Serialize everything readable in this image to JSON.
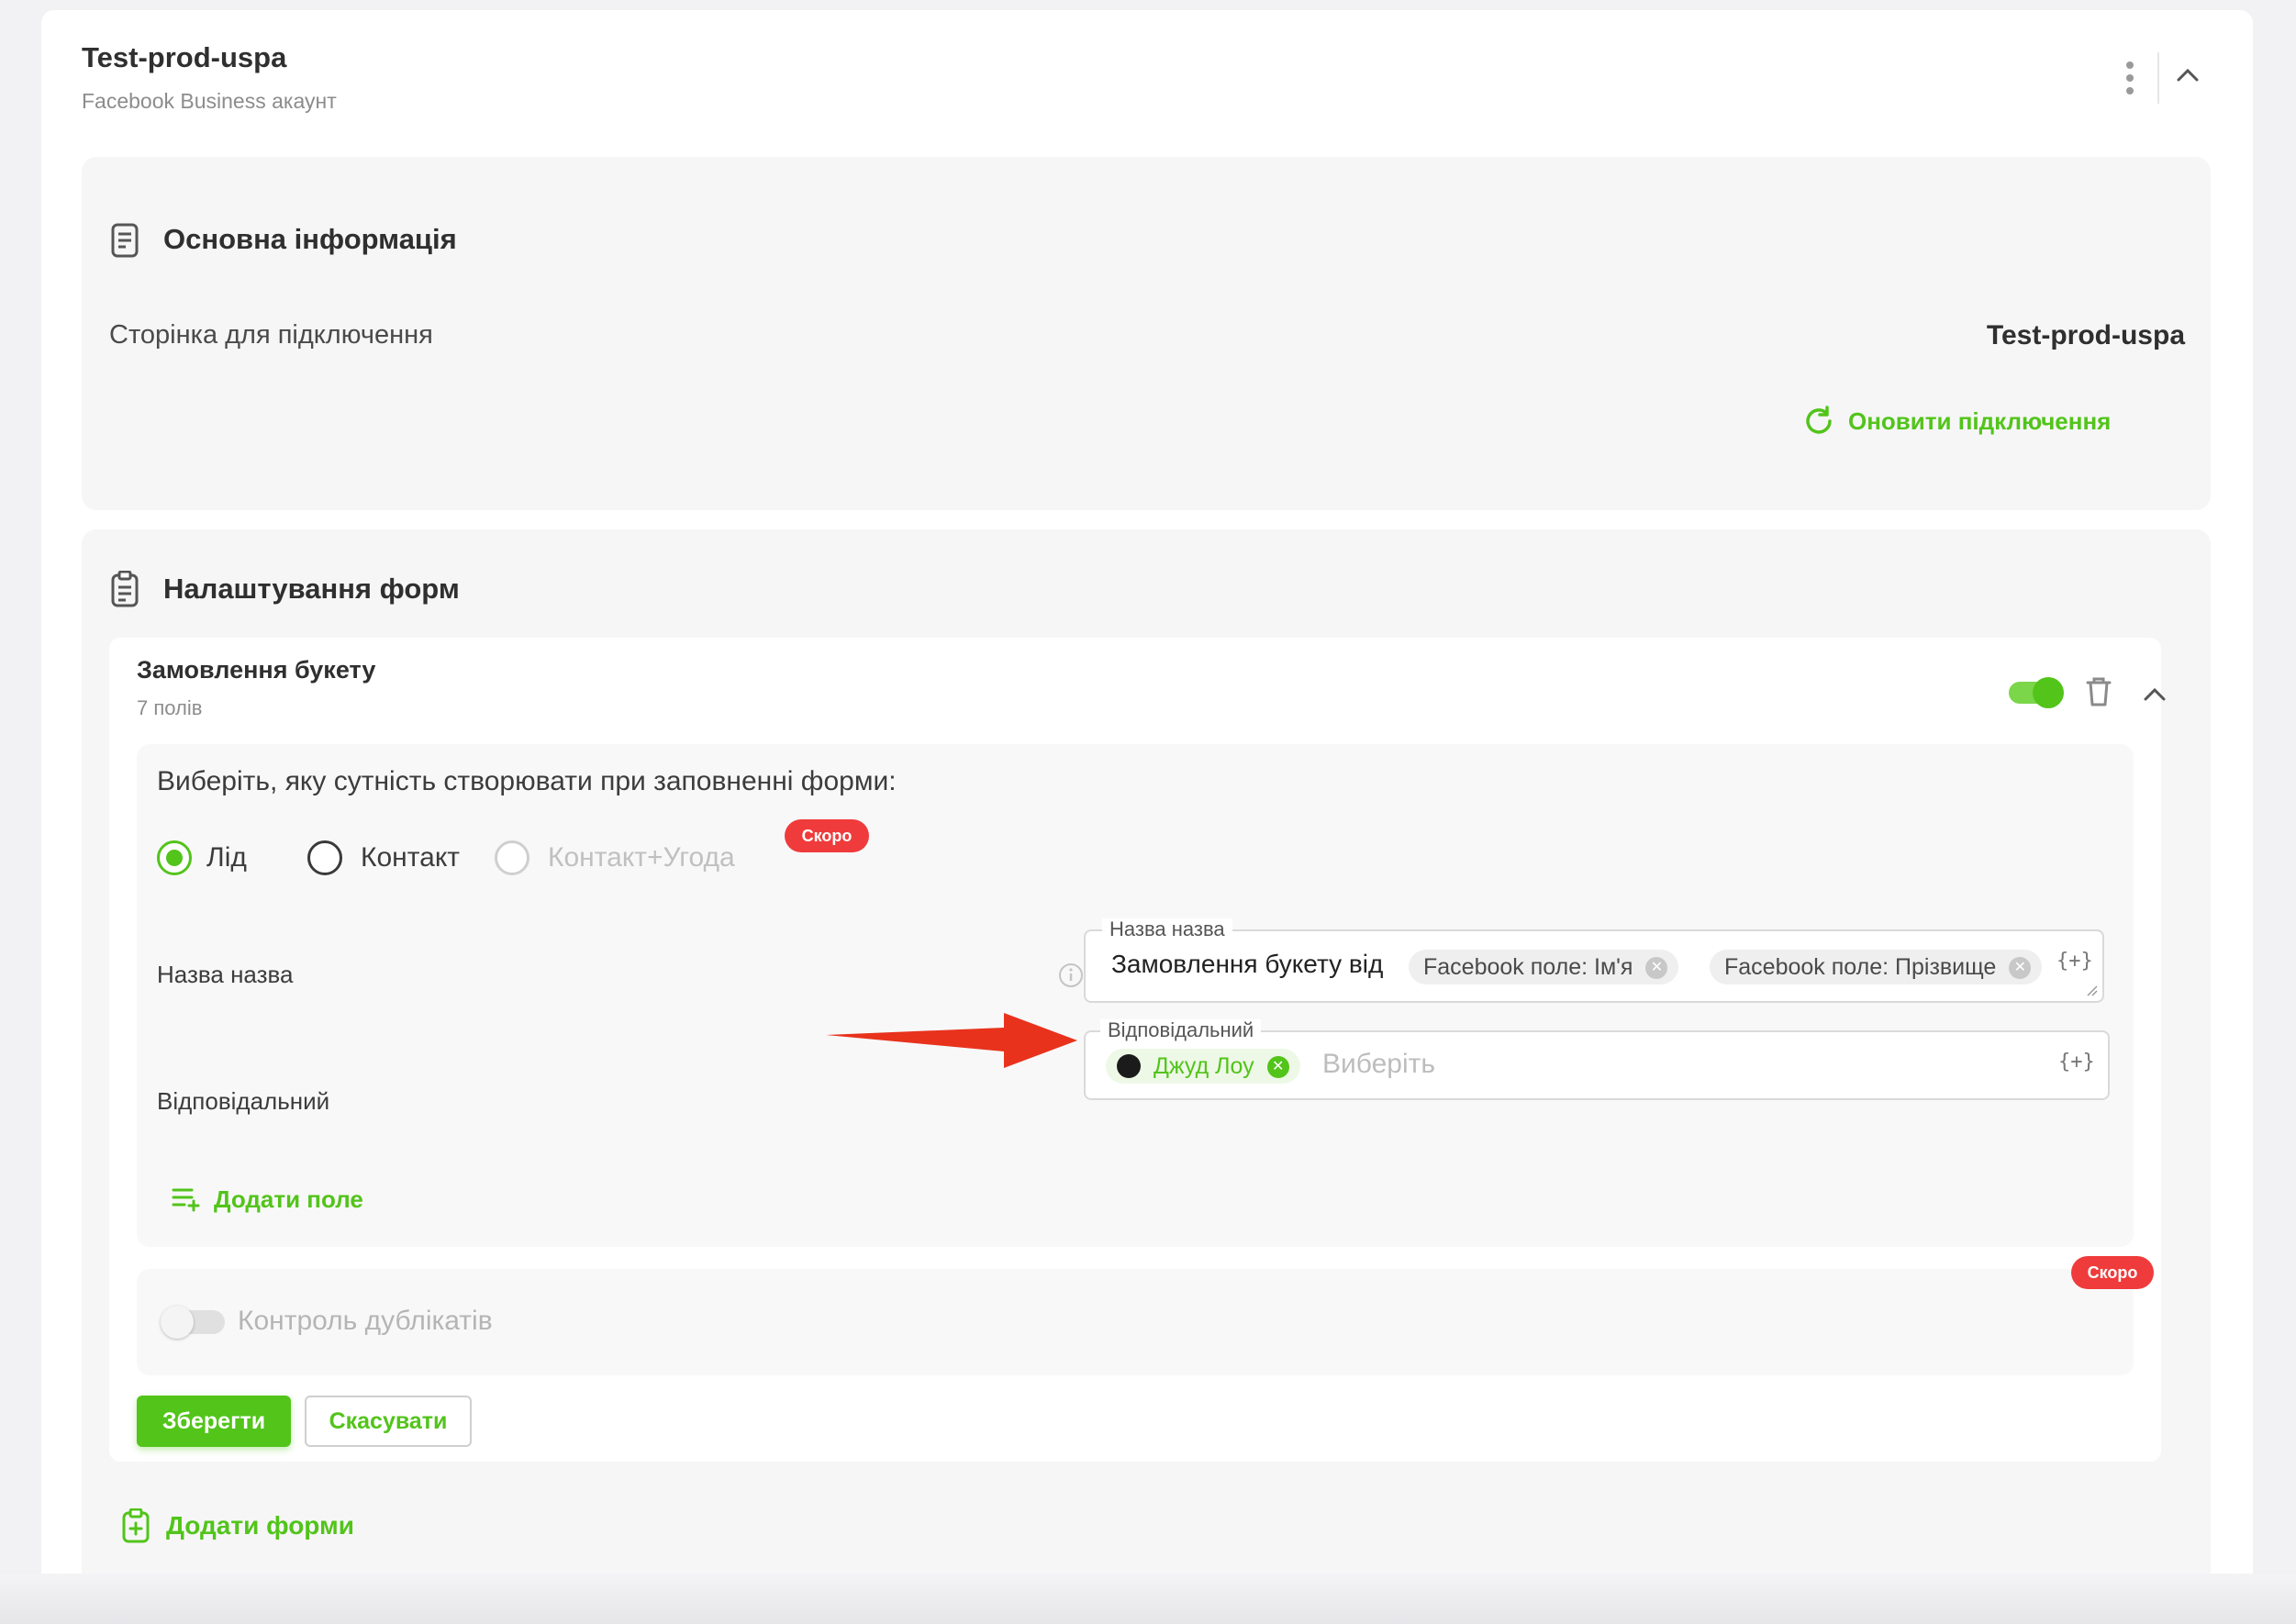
{
  "account": {
    "name": "Test-prod-uspa",
    "subtitle": "Facebook Business акаунт"
  },
  "basic_info": {
    "heading": "Основна інформація",
    "page_label": "Сторінка для підключення",
    "page_value": "Test-prod-uspa",
    "refresh_label": "Оновити підключення"
  },
  "forms_settings": {
    "heading": "Налаштування форм",
    "add_forms_label": "Додати форми"
  },
  "form": {
    "name": "Замовлення букету",
    "field_count": "7 полів",
    "enabled": true,
    "entity_question": "Виберіть, яку сутність створювати при заповненні форми:",
    "entity_options": [
      {
        "label": "Лід",
        "checked": true,
        "disabled": false
      },
      {
        "label": "Контакт",
        "checked": false,
        "disabled": false
      },
      {
        "label": "Контакт+Угода",
        "checked": false,
        "disabled": true
      }
    ],
    "soon_badge": "Скоро",
    "fields": {
      "name": {
        "label": "Назва назва",
        "legend": "Назва назва",
        "text": "Замовлення букету від",
        "chips": [
          "Facebook поле: Ім'я",
          "Facebook поле: Прізвище"
        ],
        "insert_symbol": "{+}"
      },
      "responsible": {
        "label": "Відповідальний",
        "legend": "Відповідальний",
        "chip": "Джуд Лоу",
        "placeholder": "Виберіть",
        "insert_symbol": "{+}"
      }
    },
    "add_field_label": "Додати поле",
    "duplicate_control": {
      "label": "Контроль дублікатів",
      "enabled": false,
      "soon_badge": "Скоро"
    },
    "save_label": "Зберегти",
    "cancel_label": "Скасувати"
  },
  "colors": {
    "accent": "#52c41a",
    "badge": "#ef3b3b",
    "arrow": "#e8321c"
  },
  "icons": [
    "kebab-menu-icon",
    "chevron-up-icon",
    "document-icon",
    "refresh-icon",
    "clipboard-icon",
    "trash-icon",
    "info-icon",
    "add-list-icon",
    "add-clipboard-icon",
    "avatar-icon",
    "annotation-arrow"
  ]
}
